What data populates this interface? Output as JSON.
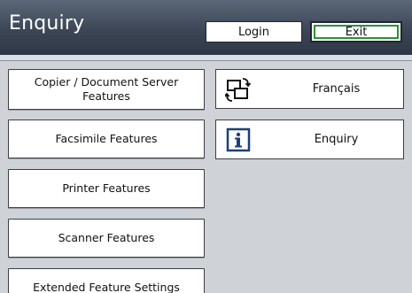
{
  "header": {
    "title": "Enquiry",
    "login_label": "Login",
    "exit_label": "Exit"
  },
  "menu": {
    "copier_line1": "Copier / Document Server",
    "copier_line2": "Features",
    "facsimile": "Facsimile Features",
    "printer": "Printer Features",
    "scanner": "Scanner Features",
    "extended": "Extended Feature Settings"
  },
  "side": {
    "language_label": "Français",
    "language_icon": "language-switch-icon",
    "enquiry_label": "Enquiry",
    "enquiry_icon": "info-icon"
  }
}
